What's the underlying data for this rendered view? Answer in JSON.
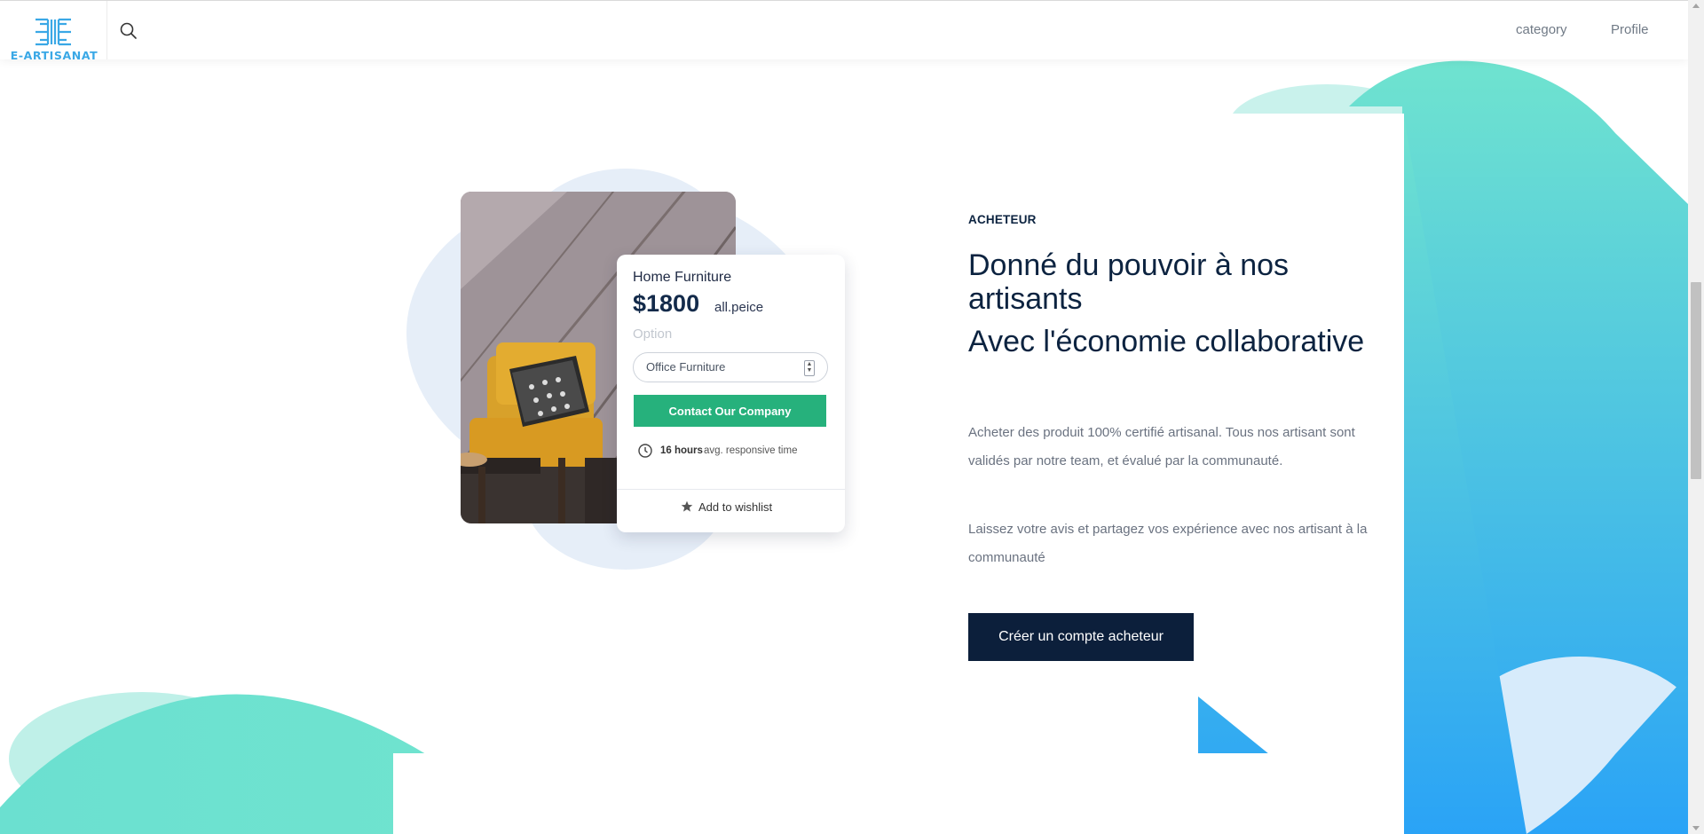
{
  "brand": {
    "name": "E-ARTISANAT"
  },
  "nav": {
    "links": [
      {
        "label": "category",
        "icon": ""
      },
      {
        "label": "Profile",
        "icon": ""
      }
    ],
    "search_icon": "search-icon"
  },
  "product_card": {
    "title": "Home Furniture",
    "price": "$1800",
    "unit": "all.peice",
    "option_label": "Option",
    "select_value": "Office Furniture",
    "button_label": "Contact Our Company",
    "response_time_strong": "16 hours",
    "response_time_rest": "avg. responsive time",
    "wishlist_label": "Add to wishlist"
  },
  "section": {
    "eyebrow": "ACHETEUR",
    "headline": "Donné du pouvoir à nos artisants",
    "subheadline": "Avec l'économie collaborative",
    "paragraph_1": "Acheter des produit 100% certifié artisanal. Tous nos artisant sont validés par notre team, et évalué par la communauté.",
    "paragraph_2": "Laissez votre avis et partagez vos expérience avec nos artisant à la communauté",
    "cta_label": "Créer un compte acheteur"
  },
  "colors": {
    "brand_blue": "#3aa8e6",
    "navy": "#0c2340",
    "green_button": "#26b17c",
    "gradient_top": "#6fe3cf",
    "gradient_bottom": "#2aa3f6"
  }
}
